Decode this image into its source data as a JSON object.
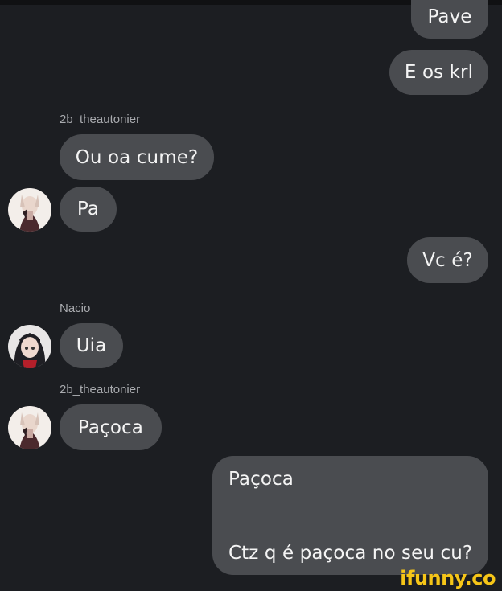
{
  "chat": {
    "messages": [
      {
        "id": "m1",
        "side": "out",
        "text": "Pave"
      },
      {
        "id": "m2",
        "side": "out",
        "text": "E os krl"
      },
      {
        "id": "m3",
        "side": "in",
        "sender": "2b_theautonier",
        "text": "Ou oa cume?"
      },
      {
        "id": "m4",
        "side": "in",
        "text": "Pa"
      },
      {
        "id": "m5",
        "side": "out",
        "text": "Vc é?"
      },
      {
        "id": "m6",
        "side": "in",
        "sender": "Nacio",
        "text": "Uia"
      },
      {
        "id": "m7",
        "side": "in",
        "sender": "2b_theautonier",
        "text": "Paçoca"
      },
      {
        "id": "m8",
        "side": "out",
        "lines": [
          "Paçoca",
          "Ctz q é paçoca no seu cu?"
        ]
      }
    ]
  },
  "watermark": {
    "text": "ifunny.co"
  },
  "colors": {
    "background": "#1c1e22",
    "bubble": "#4a4c50",
    "sender_label": "#a9abaf",
    "watermark": "#f5c518"
  },
  "icons": {
    "avatar_2b": "avatar-icon",
    "avatar_nacio": "avatar-icon"
  }
}
